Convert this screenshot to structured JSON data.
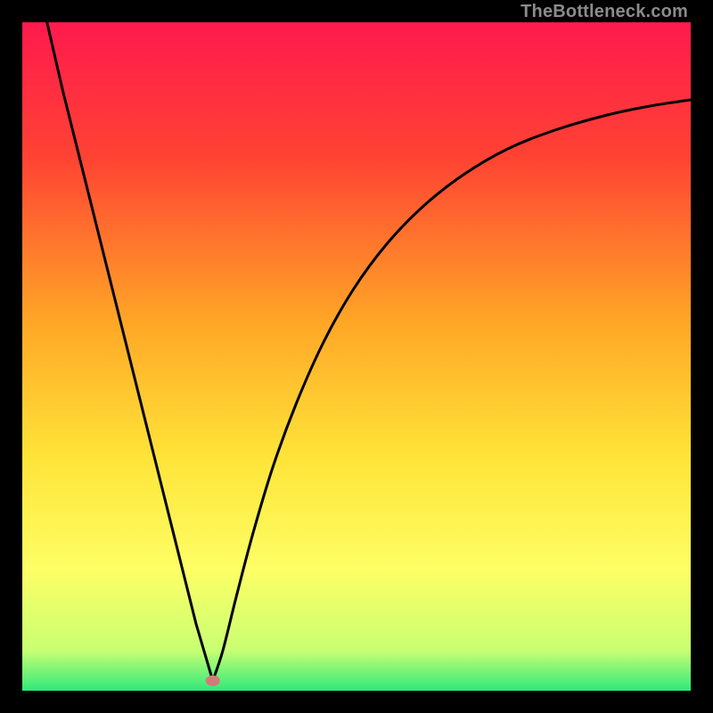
{
  "watermark": "TheBottleneck.com",
  "chart_data": {
    "type": "line",
    "title": "",
    "xlabel": "",
    "ylabel": "",
    "xlim": [
      0,
      1
    ],
    "ylim": [
      0,
      1
    ],
    "gradient_stops": [
      {
        "offset": 0.0,
        "color": "#ff1a4d"
      },
      {
        "offset": 0.2,
        "color": "#ff4233"
      },
      {
        "offset": 0.45,
        "color": "#ffa726"
      },
      {
        "offset": 0.65,
        "color": "#ffe438"
      },
      {
        "offset": 0.82,
        "color": "#fdff66"
      },
      {
        "offset": 0.94,
        "color": "#c8ff73"
      },
      {
        "offset": 1.0,
        "color": "#2fe97a"
      }
    ],
    "series": [
      {
        "name": "left-branch",
        "points": [
          {
            "x": 0.037,
            "y": 1.0
          },
          {
            "x": 0.06,
            "y": 0.9
          },
          {
            "x": 0.085,
            "y": 0.8
          },
          {
            "x": 0.11,
            "y": 0.7
          },
          {
            "x": 0.135,
            "y": 0.6
          },
          {
            "x": 0.16,
            "y": 0.5
          },
          {
            "x": 0.185,
            "y": 0.4
          },
          {
            "x": 0.21,
            "y": 0.3
          },
          {
            "x": 0.235,
            "y": 0.2
          },
          {
            "x": 0.26,
            "y": 0.1
          },
          {
            "x": 0.285,
            "y": 0.015
          }
        ]
      },
      {
        "name": "right-branch",
        "points": [
          {
            "x": 0.285,
            "y": 0.015
          },
          {
            "x": 0.3,
            "y": 0.06
          },
          {
            "x": 0.32,
            "y": 0.14
          },
          {
            "x": 0.345,
            "y": 0.235
          },
          {
            "x": 0.375,
            "y": 0.335
          },
          {
            "x": 0.41,
            "y": 0.43
          },
          {
            "x": 0.45,
            "y": 0.52
          },
          {
            "x": 0.495,
            "y": 0.6
          },
          {
            "x": 0.545,
            "y": 0.668
          },
          {
            "x": 0.6,
            "y": 0.725
          },
          {
            "x": 0.66,
            "y": 0.772
          },
          {
            "x": 0.725,
            "y": 0.81
          },
          {
            "x": 0.795,
            "y": 0.838
          },
          {
            "x": 0.87,
            "y": 0.86
          },
          {
            "x": 0.935,
            "y": 0.874
          },
          {
            "x": 1.0,
            "y": 0.884
          }
        ]
      }
    ],
    "marker": {
      "x": 0.285,
      "y": 0.015,
      "rx": 8,
      "ry": 6,
      "color": "#d27a7a"
    }
  }
}
